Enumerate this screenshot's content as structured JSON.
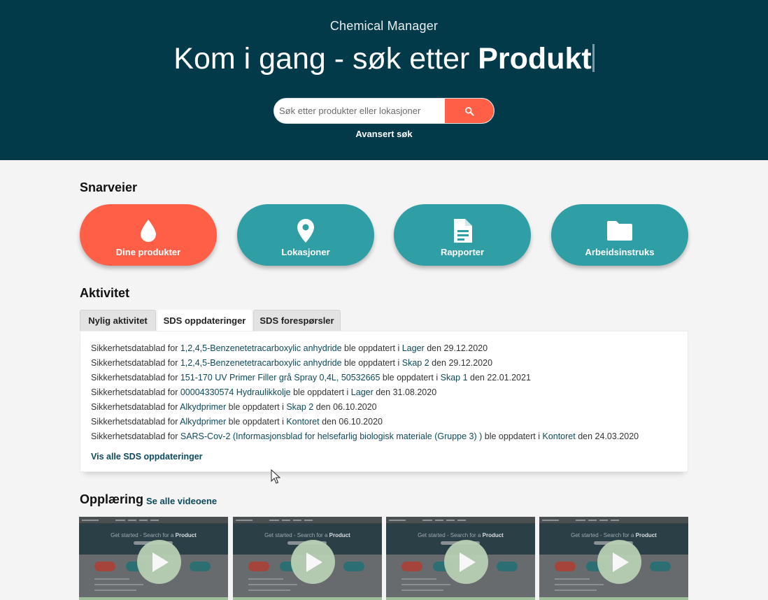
{
  "hero": {
    "app_name": "Chemical Manager",
    "headline_prefix": "Kom i gang - søk etter",
    "headline_bold": "Produkt",
    "search_placeholder": "Søk etter produkter eller lokasjoner",
    "search_icon": "search-icon",
    "advanced_search": "Avansert søk"
  },
  "shortcuts": {
    "title": "Snarveier",
    "items": [
      {
        "label": "Dine produkter",
        "icon": "droplet-icon",
        "color": "#ff5f46"
      },
      {
        "label": "Lokasjoner",
        "icon": "location-pin-icon",
        "color": "#2f9ea5"
      },
      {
        "label": "Rapporter",
        "icon": "document-icon",
        "color": "#2f9ea5"
      },
      {
        "label": "Arbeidsinstruks",
        "icon": "folder-icon",
        "color": "#2f9ea5"
      }
    ]
  },
  "activity": {
    "title": "Aktivitet",
    "tabs": [
      {
        "label": "Nylig aktivitet",
        "active": false
      },
      {
        "label": "SDS oppdateringer",
        "active": true
      },
      {
        "label": "SDS forespørsler",
        "active": false
      }
    ],
    "updates": [
      {
        "prefix": "Sikkerhetsdatablad for ",
        "product": "1,2,4,5-Benzenetetracarboxylic anhydride",
        "middle": " ble oppdatert i ",
        "location": "Lager",
        "suffix": " den 29.12.2020"
      },
      {
        "prefix": "Sikkerhetsdatablad for ",
        "product": "1,2,4,5-Benzenetetracarboxylic anhydride",
        "middle": " ble oppdatert i ",
        "location": "Skap 2",
        "suffix": " den 29.12.2020"
      },
      {
        "prefix": "Sikkerhetsdatablad for ",
        "product": "151-170 UV Primer Filler grå Spray 0,4L, 50532665",
        "middle": " ble oppdatert i ",
        "location": "Skap 1",
        "suffix": " den 22.01.2021"
      },
      {
        "prefix": "Sikkerhetsdatablad for ",
        "product": "00004330574 Hydraulikkolje",
        "middle": " ble oppdatert i ",
        "location": "Lager",
        "suffix": " den 31.08.2020"
      },
      {
        "prefix": "Sikkerhetsdatablad for ",
        "product": "Alkydprimer",
        "middle": " ble oppdatert i ",
        "location": "Skap 2",
        "suffix": " den 06.10.2020"
      },
      {
        "prefix": "Sikkerhetsdatablad for ",
        "product": "Alkydprimer",
        "middle": " ble oppdatert i ",
        "location": "Kontoret",
        "suffix": " den 06.10.2020"
      },
      {
        "prefix": "Sikkerhetsdatablad for ",
        "product": "SARS-Cov-2 (Informasjonsblad for helsefarlig biologisk materiale (Gruppe 3) )",
        "middle": " ble oppdatert i ",
        "location": "Kontoret",
        "suffix": " den 24.03.2020"
      }
    ],
    "view_all": "Vis alle SDS oppdateringer"
  },
  "training": {
    "title": "Opplæring",
    "see_all": "Se alle videoene",
    "video_thumb_text": "Get started - Search for a",
    "video_thumb_bold": "Product",
    "play_icon": "play-icon",
    "video_count": 4
  },
  "colors": {
    "hero_bg": "#033a4a",
    "accent": "#ff5f46",
    "teal": "#2f9ea5",
    "link": "#0d4a5c"
  }
}
